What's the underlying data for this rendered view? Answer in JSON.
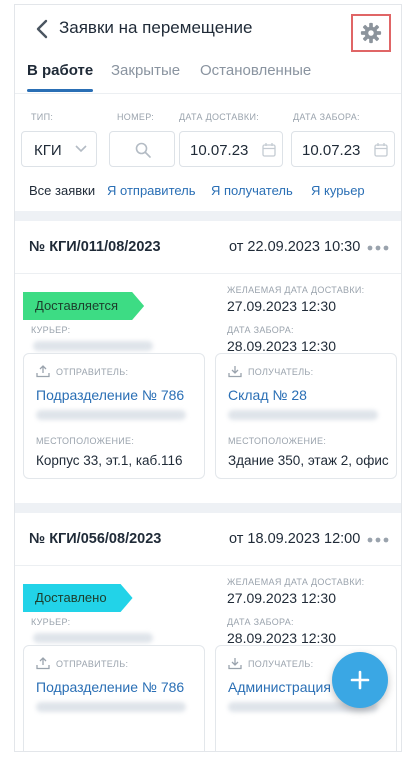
{
  "header": {
    "title": "Заявки на перемещение",
    "back_icon": "chevron-left-icon",
    "settings_icon": "gear-icon"
  },
  "tabs": [
    {
      "label": "В работе",
      "active": true
    },
    {
      "label": "Закрытые",
      "active": false
    },
    {
      "label": "Остановленные",
      "active": false
    }
  ],
  "filters": {
    "type_label": "ТИП:",
    "type_value": "КГИ",
    "number_label": "НОМЕР:",
    "delivery_label": "ДАТА ДОСТАВКИ:",
    "delivery_value": "10.07.23",
    "pickup_label": "ДАТА ЗАБОРА:",
    "pickup_value": "10.07.23",
    "quick": [
      "Все заявки",
      "Я отправитель",
      "Я получатель",
      "Я курьер"
    ]
  },
  "cards": [
    {
      "number": "№ КГИ/011/08/2023",
      "date": "от 22.09.2023 10:30",
      "status": "Доставляется",
      "status_color": "#3ddc84",
      "courier_label": "КУРЬЕР:",
      "desired_label": "ЖЕЛАЕМАЯ ДАТА ДОСТАВКИ:",
      "desired_value": "27.09.2023 12:30",
      "pickup_label": "ДАТА ЗАБОРА:",
      "pickup_value": "28.09.2023 12:30",
      "sender_label": "ОТПРАВИТЕЛЬ:",
      "sender_name": "Подразделение № 786",
      "sender_loc_label": "МЕСТОПОЛОЖЕНИЕ:",
      "sender_loc": "Корпус 33, эт.1, каб.116",
      "recipient_label": "ПОЛУЧАТЕЛЬ:",
      "recipient_name": "Склад № 28",
      "recipient_loc_label": "МЕСТОПОЛОЖЕНИЕ:",
      "recipient_loc": "Здание 350, этаж 2, офис"
    },
    {
      "number": "№ КГИ/056/08/2023",
      "date": "от 18.09.2023 12:00",
      "status": "Доставлено",
      "status_color": "#22d3e8",
      "courier_label": "КУРЬЕР:",
      "desired_label": "ЖЕЛАЕМАЯ ДАТА ДОСТАВКИ:",
      "desired_value": "27.09.2023 12:30",
      "pickup_label": "ДАТА ЗАБОРА:",
      "pickup_value": "28.09.2023 12:30",
      "sender_label": "ОТПРАВИТЕЛЬ:",
      "sender_name": "Подразделение № 786",
      "recipient_label": "ПОЛУЧАТЕЛЬ:",
      "recipient_name": "Администрация в"
    }
  ],
  "fab_icon": "plus-icon",
  "colors": {
    "accent": "#2a6fb5",
    "fab": "#3aa7e4",
    "highlight": "#e06566"
  }
}
